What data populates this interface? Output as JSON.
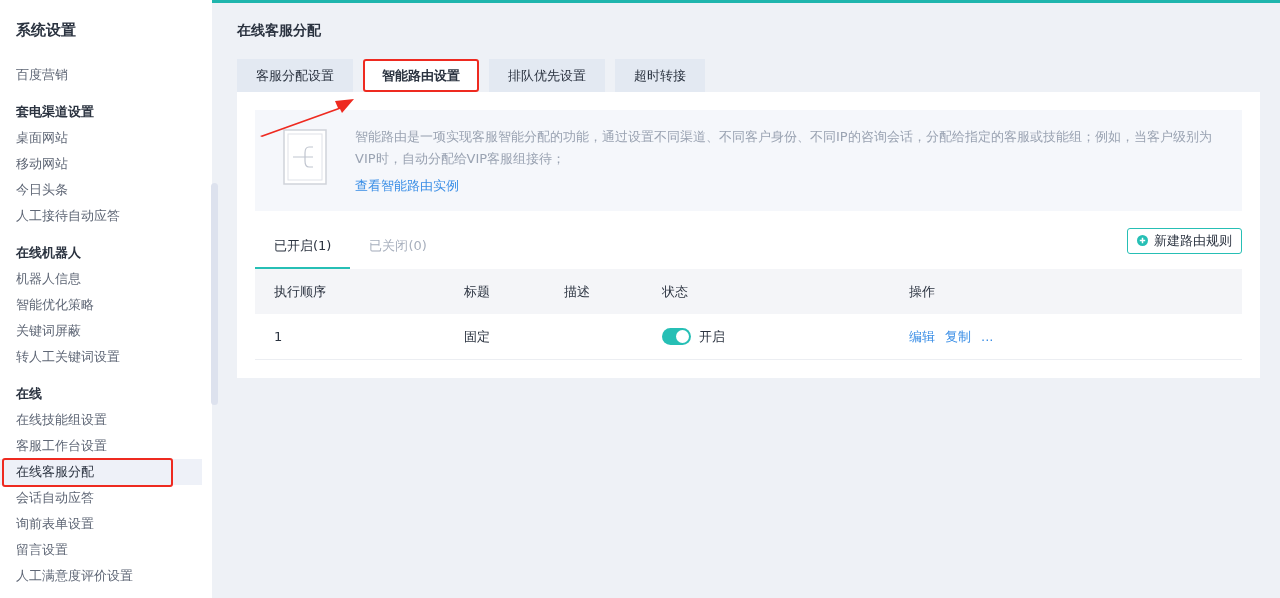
{
  "sidebar": {
    "title": "系统设置",
    "groups": [
      {
        "items": [
          {
            "label": "百度营销",
            "selected": false,
            "highlighted": false
          }
        ]
      },
      {
        "title": "套电渠道设置",
        "items": [
          {
            "label": "桌面网站",
            "selected": false,
            "highlighted": false
          },
          {
            "label": "移动网站",
            "selected": false,
            "highlighted": false
          },
          {
            "label": "今日头条",
            "selected": false,
            "highlighted": false
          },
          {
            "label": "人工接待自动应答",
            "selected": false,
            "highlighted": false
          }
        ]
      },
      {
        "title": "在线机器人",
        "items": [
          {
            "label": "机器人信息",
            "selected": false,
            "highlighted": false
          },
          {
            "label": "智能优化策略",
            "selected": false,
            "highlighted": false
          },
          {
            "label": "关键词屏蔽",
            "selected": false,
            "highlighted": false
          },
          {
            "label": "转人工关键词设置",
            "selected": false,
            "highlighted": false
          }
        ]
      },
      {
        "title": "在线",
        "items": [
          {
            "label": "在线技能组设置",
            "selected": false,
            "highlighted": false
          },
          {
            "label": "客服工作台设置",
            "selected": false,
            "highlighted": false
          },
          {
            "label": "在线客服分配",
            "selected": true,
            "highlighted": true
          },
          {
            "label": "会话自动应答",
            "selected": false,
            "highlighted": false
          },
          {
            "label": "询前表单设置",
            "selected": false,
            "highlighted": false
          },
          {
            "label": "留言设置",
            "selected": false,
            "highlighted": false
          },
          {
            "label": "人工满意度评价设置",
            "selected": false,
            "highlighted": false
          }
        ]
      }
    ]
  },
  "page_title": "在线客服分配",
  "tabs": [
    {
      "label": "客服分配设置",
      "selected": false,
      "highlighted": false
    },
    {
      "label": "智能路由设置",
      "selected": true,
      "highlighted": true
    },
    {
      "label": "排队优先设置",
      "selected": false,
      "highlighted": false
    },
    {
      "label": "超时转接",
      "selected": false,
      "highlighted": false
    }
  ],
  "annotation_arrow": true,
  "info": {
    "text": "智能路由是一项实现客服智能分配的功能，通过设置不同渠道、不同客户身份、不同IP的咨询会话，分配给指定的客服或技能组；例如，当客户级别为VIP时，自动分配给VIP客服组接待；",
    "link": "查看智能路由实例"
  },
  "sub_tabs": [
    {
      "label": "已开启(1)",
      "selected": true
    },
    {
      "label": "已关闭(0)",
      "selected": false
    }
  ],
  "new_button": "新建路由规则",
  "table": {
    "columns": [
      "执行顺序",
      "标题",
      "描述",
      "状态",
      "操作"
    ],
    "rows": [
      {
        "order": "1",
        "title": "固定",
        "description": "",
        "on": true,
        "status": "开启",
        "actions": [
          "编辑",
          "复制",
          "..."
        ]
      }
    ]
  }
}
